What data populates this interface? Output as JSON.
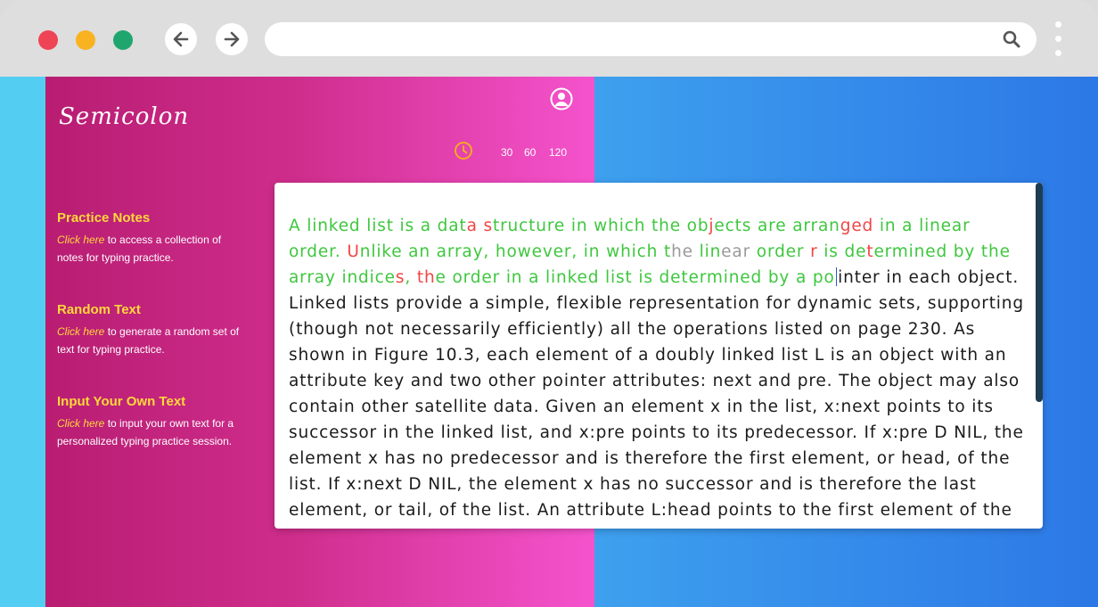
{
  "browser": {
    "url": "",
    "dots": {
      "close": "#ef4456",
      "minimize": "#f9b321",
      "maximize": "#1fa66f"
    }
  },
  "app": {
    "logo": "Semicolon",
    "timer_options": [
      "30",
      "60",
      "120"
    ]
  },
  "sidebar": {
    "items": [
      {
        "title": "Practice Notes",
        "link": "Click here",
        "desc": " to access a collection of notes for typing practice."
      },
      {
        "title": "Random Text",
        "link": "Click here",
        "desc": " to generate a random set of text for typing practice."
      },
      {
        "title": "Input Your Own Text",
        "link": "Click here",
        "desc": " to input your own text for a personalized typing practice session."
      }
    ]
  },
  "typing": {
    "lines": [
      [
        [
          "A linked list is a dat",
          "ok"
        ],
        [
          "a",
          "err"
        ],
        [
          " ",
          "ok"
        ],
        [
          "s",
          "err"
        ],
        [
          "tructure in which the ob",
          "ok"
        ],
        [
          "j",
          "err"
        ],
        [
          "ects are arran",
          "ok"
        ],
        [
          "ged",
          "err"
        ],
        [
          " in a linear",
          "ok"
        ]
      ],
      [
        [
          "order. ",
          "ok"
        ],
        [
          "U",
          "err"
        ],
        [
          "nlike an array, however, in which t",
          "ok"
        ],
        [
          "he",
          "skip"
        ],
        [
          " lin",
          "ok"
        ],
        [
          "ear",
          "skip"
        ],
        [
          " order ",
          "ok"
        ],
        [
          "r",
          "err"
        ],
        [
          " is de",
          "ok"
        ],
        [
          "t",
          "err"
        ],
        [
          "ermined by the",
          "ok"
        ]
      ],
      [
        [
          "array indice",
          "ok"
        ],
        [
          "s",
          "err"
        ],
        [
          ", ",
          "ok"
        ],
        [
          "th",
          "err"
        ],
        [
          "e order in a linked list is determined by a po",
          "ok"
        ],
        [
          "",
          "caret"
        ],
        [
          "inter in each object.",
          "plain"
        ]
      ],
      [
        [
          "Linked lists provide a simple, flexible representation for dynamic sets, supporting",
          "plain"
        ]
      ],
      [
        [
          "(though not necessarily efficiently) all the operations listed on page 230. As",
          "plain"
        ]
      ],
      [
        [
          "shown in Figure 10.3, each element of a doubly linked list L is an object with an",
          "plain"
        ]
      ],
      [
        [
          "attribute key and two other pointer attributes: next and pre. The object may also",
          "plain"
        ]
      ],
      [
        [
          "contain other satellite data. Given an element x in the list, x:next points to its",
          "plain"
        ]
      ],
      [
        [
          "successor in the linked list, and x:pre points to its predecessor. If x:pre D NIL, the",
          "plain"
        ]
      ],
      [
        [
          "element x has no predecessor and is therefore the first element, or head, of the",
          "plain"
        ]
      ],
      [
        [
          "list. If x:next D NIL, the element x has no successor and is therefore the last",
          "plain"
        ]
      ],
      [
        [
          "element, or tail, of the list. An attribute L:head points to the first element of the",
          "plain"
        ]
      ]
    ]
  }
}
